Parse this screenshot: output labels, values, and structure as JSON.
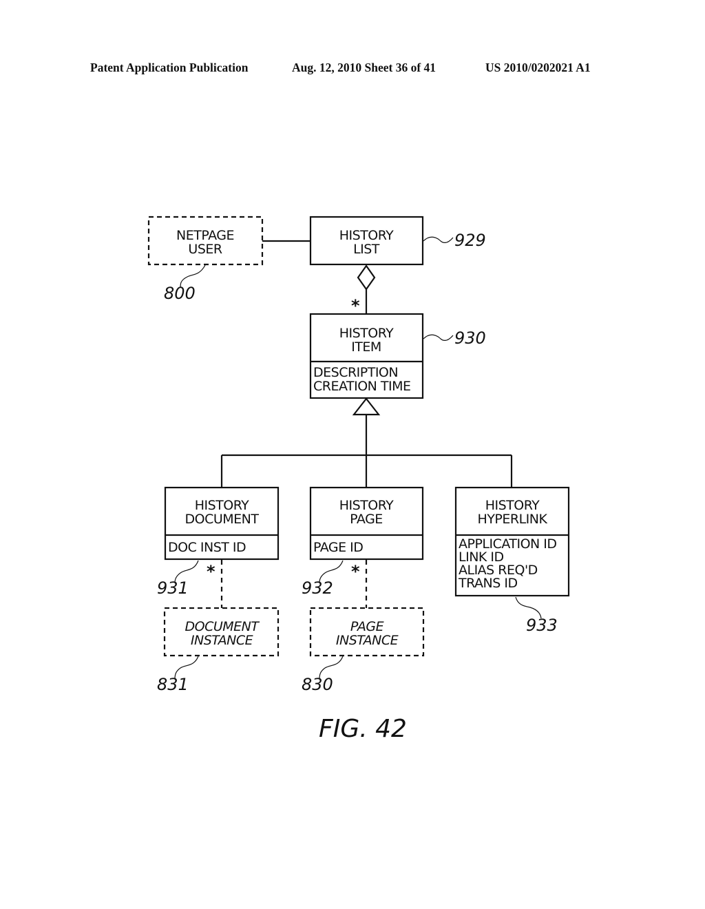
{
  "header": {
    "publication": "Patent Application Publication",
    "date_sheet": "Aug. 12, 2010  Sheet 36 of 41",
    "number": "US 2010/0202021 A1"
  },
  "diagram": {
    "figure_label": "FIG. 42",
    "nodes": {
      "netpage_user": {
        "lines": [
          "NETPAGE",
          "USER"
        ],
        "ref": "800",
        "style": "dashed"
      },
      "history_list": {
        "lines": [
          "HISTORY",
          "LIST"
        ],
        "ref": "929"
      },
      "history_item": {
        "lines": [
          "HISTORY",
          "ITEM"
        ],
        "attributes": [
          "DESCRIPTION",
          "CREATION TIME"
        ],
        "ref": "930"
      },
      "history_document": {
        "lines": [
          "HISTORY",
          "DOCUMENT"
        ],
        "attributes": [
          "DOC INST ID"
        ],
        "ref": "931"
      },
      "history_page": {
        "lines": [
          "HISTORY",
          "PAGE"
        ],
        "attributes": [
          "PAGE ID"
        ],
        "ref": "932"
      },
      "history_hyperlink": {
        "lines": [
          "HISTORY",
          "HYPERLINK"
        ],
        "attributes": [
          "APPLICATION ID",
          "LINK ID",
          "ALIAS REQ'D",
          "TRANS ID"
        ],
        "ref": "933"
      },
      "document_instance": {
        "lines": [
          "DOCUMENT",
          "INSTANCE"
        ],
        "ref": "831",
        "style": "dashed"
      },
      "page_instance": {
        "lines": [
          "PAGE",
          "INSTANCE"
        ],
        "ref": "830",
        "style": "dashed"
      }
    },
    "multiplicity": "*",
    "edges": [
      {
        "from": "netpage_user",
        "to": "history_list",
        "type": "association"
      },
      {
        "from": "history_list",
        "to": "history_item",
        "type": "aggregation",
        "multiplicity": "*"
      },
      {
        "from": "history_document",
        "to": "history_item",
        "type": "generalization"
      },
      {
        "from": "history_page",
        "to": "history_item",
        "type": "generalization"
      },
      {
        "from": "history_hyperlink",
        "to": "history_item",
        "type": "generalization"
      },
      {
        "from": "history_document",
        "to": "document_instance",
        "type": "dashed-association",
        "multiplicity": "*"
      },
      {
        "from": "history_page",
        "to": "page_instance",
        "type": "dashed-association",
        "multiplicity": "*"
      }
    ]
  }
}
